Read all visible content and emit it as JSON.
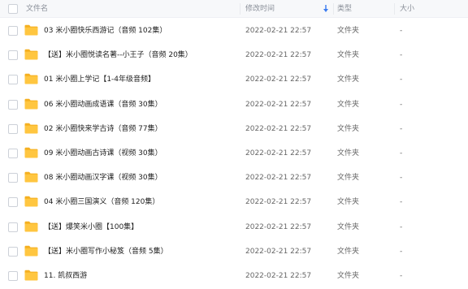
{
  "header": {
    "name": "文件名",
    "modified": "修改时间",
    "type": "类型",
    "size": "大小"
  },
  "colors": {
    "folder": "#ffc640",
    "folder_tab": "#f5b021",
    "sort_arrow": "#3b7cf0"
  },
  "files": [
    {
      "name": "03 米小圈快乐西游记（音频 102集）",
      "modified": "2022-02-21 22:57",
      "type": "文件夹",
      "size": "-"
    },
    {
      "name": "【送】米小圈悦读名著--小王子（音频 20集）",
      "modified": "2022-02-21 22:57",
      "type": "文件夹",
      "size": "-"
    },
    {
      "name": "01 米小圈上学记【1-4年级音频】",
      "modified": "2022-02-21 22:57",
      "type": "文件夹",
      "size": "-"
    },
    {
      "name": "06 米小圈动画成语课（音频 30集）",
      "modified": "2022-02-21 22:57",
      "type": "文件夹",
      "size": "-"
    },
    {
      "name": "02 米小圈快来学古诗（音频 77集）",
      "modified": "2022-02-21 22:57",
      "type": "文件夹",
      "size": "-"
    },
    {
      "name": "09 米小圈动画古诗课（视频 30集）",
      "modified": "2022-02-21 22:57",
      "type": "文件夹",
      "size": "-"
    },
    {
      "name": "08 米小圈动画汉字课（视频 30集）",
      "modified": "2022-02-21 22:57",
      "type": "文件夹",
      "size": "-"
    },
    {
      "name": "04 米小圈三国演义（音频 120集）",
      "modified": "2022-02-21 22:57",
      "type": "文件夹",
      "size": "-"
    },
    {
      "name": "【送】爆笑米小圈【100集】",
      "modified": "2022-02-21 22:57",
      "type": "文件夹",
      "size": "-"
    },
    {
      "name": "【送】米小圈写作小秘笈（音频 5集）",
      "modified": "2022-02-21 22:57",
      "type": "文件夹",
      "size": "-"
    },
    {
      "name": "11. 凯叔西游",
      "modified": "2022-02-21 22:57",
      "type": "文件夹",
      "size": "-"
    }
  ]
}
